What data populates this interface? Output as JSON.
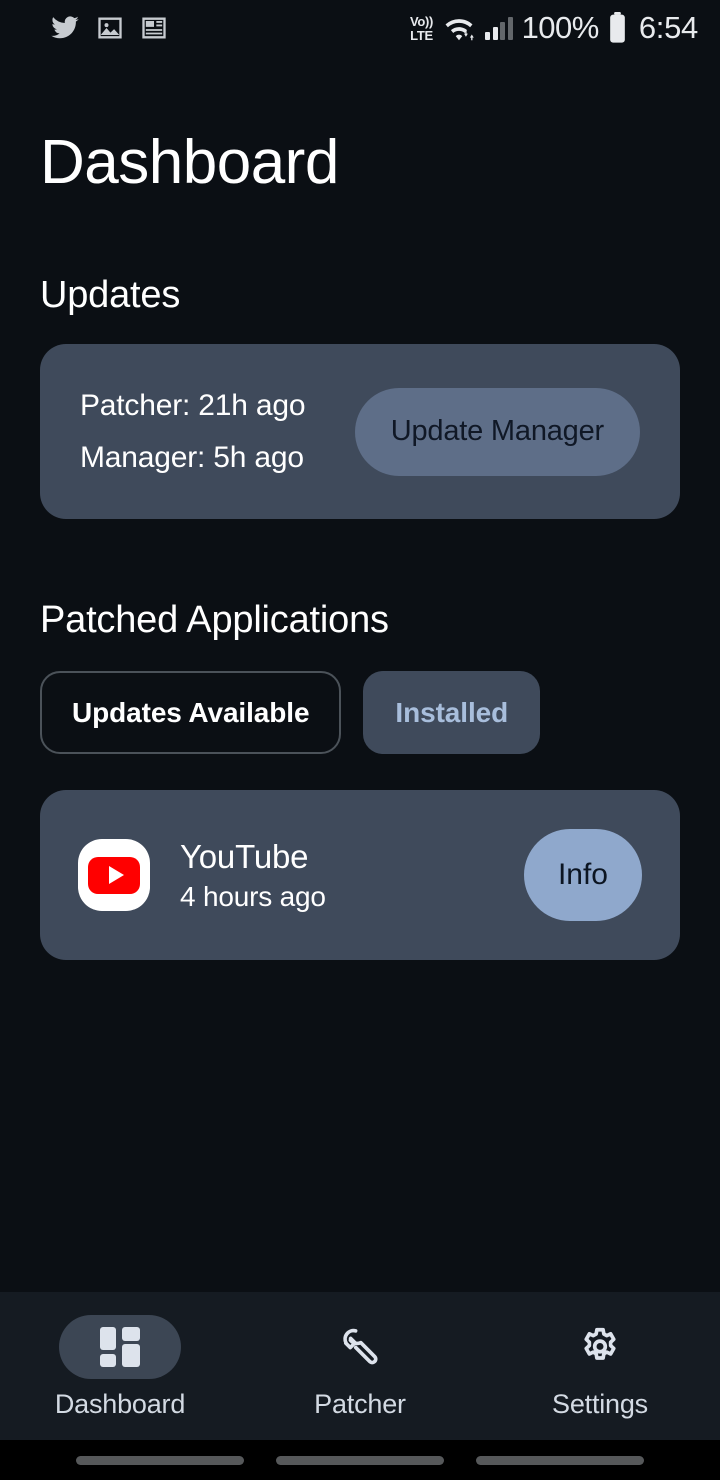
{
  "status_bar": {
    "notification_icons": [
      "twitter-icon",
      "photo-icon",
      "news-icon"
    ],
    "network_type_line1": "Vo))",
    "network_type_line2": "LTE",
    "wifi": "wifi-icon",
    "signal": "signal-bars-icon",
    "battery_percent": "100%",
    "battery": "battery-full-icon",
    "time": "6:54"
  },
  "header": {
    "title": "Dashboard"
  },
  "updates": {
    "section_title": "Updates",
    "patcher_line": "Patcher: 21h ago",
    "manager_line": "Manager: 5h ago",
    "update_manager_label": "Update Manager"
  },
  "patched_applications": {
    "section_title": "Patched Applications",
    "filters": [
      {
        "label": "Updates Available",
        "selected": false
      },
      {
        "label": "Installed",
        "selected": true
      }
    ],
    "apps": [
      {
        "icon": "youtube-icon",
        "name": "YouTube",
        "subtitle": "4 hours ago",
        "action_label": "Info"
      }
    ]
  },
  "bottom_nav": {
    "items": [
      {
        "label": "Dashboard",
        "icon": "dashboard-grid-icon",
        "active": true
      },
      {
        "label": "Patcher",
        "icon": "wrench-icon",
        "active": false
      },
      {
        "label": "Settings",
        "icon": "gear-icon",
        "active": false
      }
    ]
  },
  "colors": {
    "background": "#0B0F14",
    "card": "#3F4A5B",
    "accent_button": "#8FA8CC",
    "muted_button": "#5E6E88",
    "chip_selected_text": "#A8BEDC",
    "nav_bar": "#151B22",
    "nav_pill_active": "#3C4654",
    "youtube_red": "#FF0000"
  }
}
